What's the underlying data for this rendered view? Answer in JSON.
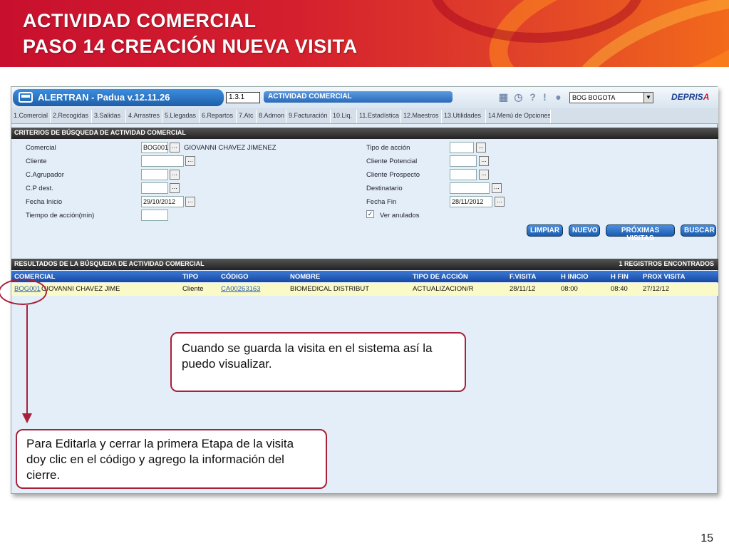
{
  "slide": {
    "title_line1": "ACTIVIDAD COMERCIAL",
    "title_line2": "PASO 14 CREACIÓN NUEVA VISITA",
    "page_number": "15"
  },
  "app": {
    "title": "ALERTRAN - Padua  v.12.11.26",
    "version_code": "1.3.1",
    "module": "ACTIVIDAD COMERCIAL",
    "city_select": "BOG BOGOTA",
    "logo_main": "DEPRIS",
    "logo_accent": "A",
    "toolbar_icons": [
      "calendar-icon",
      "clock-icon",
      "help-icon",
      "info-icon",
      "user-icon"
    ]
  },
  "menu": {
    "tabs": [
      "1.Comercial",
      "2.Recogidas",
      "3.Salidas",
      "4.Arrastres",
      "5.Llegadas",
      "6.Repartos",
      "7.Atc",
      "8.Admon",
      "9.Facturación",
      "10.Liq.",
      "11.Estadística",
      "12.Maestros",
      "13.Utilidades",
      "14.Menú de Opciones"
    ]
  },
  "criteria": {
    "section_title": "CRITERIOS DE BÚSQUEDA DE ACTIVIDAD COMERCIAL",
    "comercial_label": "Comercial",
    "comercial_value": "BOG001",
    "comercial_name": "GIOVANNI CHAVEZ JIMENEZ",
    "cliente_label": "Cliente",
    "cagrupador_label": "C.Agrupador",
    "cp_dest_label": "C.P dest.",
    "fecha_inicio_label": "Fecha Inicio",
    "fecha_inicio_value": "29/10/2012",
    "tiempo_label": "Tiempo de acción(min)",
    "tipo_accion_label": "Tipo de acción",
    "cliente_potencial_label": "Cliente Potencial",
    "cliente_prospecto_label": "Cliente Prospecto",
    "destinatario_label": "Destinatario",
    "fecha_fin_label": "Fecha Fin",
    "fecha_fin_value": "28/11/2012",
    "ver_anulados_label": "Ver anulados",
    "ver_anulados_checked": "✓",
    "dots_label": "..."
  },
  "actions": {
    "limpiar": "LIMPIAR",
    "nuevo": "NUEVO",
    "proximas": "PRÓXIMAS VISITAS",
    "buscar": "BUSCAR"
  },
  "results": {
    "section_title": "RESULTADOS DE LA BÚSQUEDA DE ACTIVIDAD COMERCIAL",
    "count_text": "1 REGISTROS ENCONTRADOS",
    "headers": [
      "COMERCIAL",
      "TIPO",
      "CÓDIGO",
      "NOMBRE",
      "TIPO DE ACCIÓN",
      "F.VISITA",
      "H INICIO",
      "H FIN",
      "PROX VISITA"
    ],
    "row": {
      "comercial_code": "BOG001",
      "comercial_name": "GIOVANNI CHAVEZ JIME",
      "tipo": "Cliente",
      "codigo": "CA00263163",
      "nombre": "BIOMEDICAL DISTRIBUT",
      "tipo_accion": "ACTUALIZACION/R",
      "f_visita": "28/11/12",
      "h_inicio": "08:00",
      "h_fin": "08:40",
      "prox_visita": "27/12/12"
    }
  },
  "callouts": {
    "saved_note": "Cuando se guarda la visita en el sistema así la puedo visualizar.",
    "edit_note": "Para Editarla y cerrar la primera Etapa de la visita doy clic en el código y agrego la información del cierre."
  },
  "colors": {
    "banner_red": "#c8102e",
    "banner_orange": "#f26a1b",
    "callout_border": "#a8203a",
    "header_blue": "#1848a0",
    "row_highlight": "#fafac8"
  }
}
